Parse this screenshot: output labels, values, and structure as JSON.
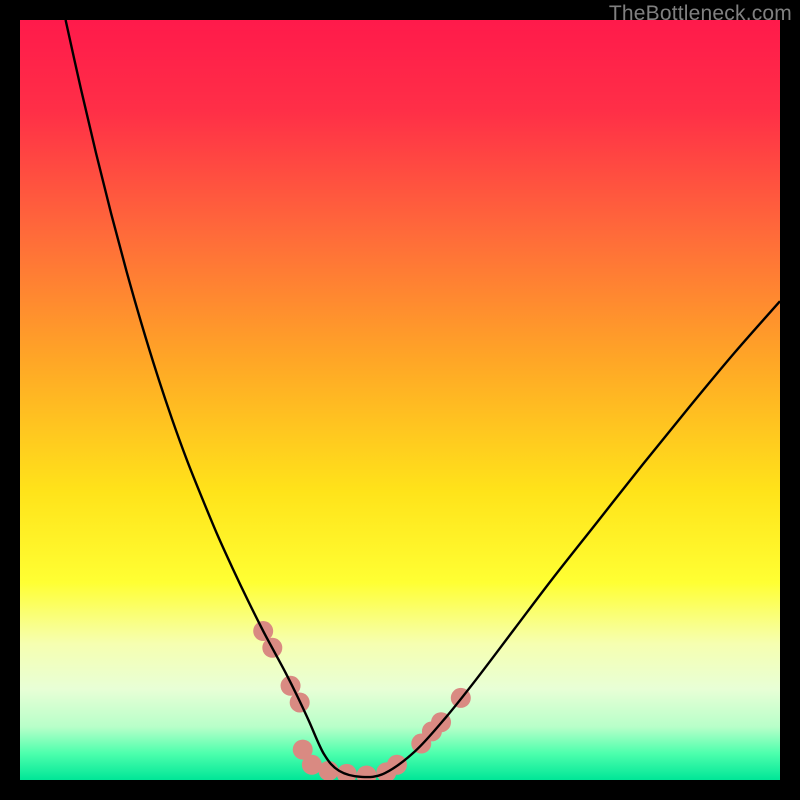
{
  "watermark": "TheBottleneck.com",
  "chart_data": {
    "type": "line",
    "title": "",
    "xlabel": "",
    "ylabel": "",
    "xlim": [
      0,
      100
    ],
    "ylim": [
      0,
      100
    ],
    "background_gradient": {
      "stops": [
        {
          "offset": 0.0,
          "color": "#ff1a4b"
        },
        {
          "offset": 0.12,
          "color": "#ff2f47"
        },
        {
          "offset": 0.28,
          "color": "#ff6a3a"
        },
        {
          "offset": 0.45,
          "color": "#ffa726"
        },
        {
          "offset": 0.62,
          "color": "#ffe31a"
        },
        {
          "offset": 0.74,
          "color": "#ffff33"
        },
        {
          "offset": 0.82,
          "color": "#f6ffb0"
        },
        {
          "offset": 0.88,
          "color": "#e8ffd6"
        },
        {
          "offset": 0.93,
          "color": "#b8ffc9"
        },
        {
          "offset": 0.965,
          "color": "#4dffad"
        },
        {
          "offset": 1.0,
          "color": "#00e697"
        }
      ]
    },
    "series": [
      {
        "name": "bottleneck-curve",
        "color": "#000000",
        "stroke_width": 2.4,
        "x": [
          6,
          8,
          10,
          12,
          14,
          16,
          18,
          20,
          22,
          24,
          26,
          28,
          30,
          32,
          33.5,
          35,
          36.5,
          38,
          40,
          42,
          45,
          48,
          52,
          56,
          60,
          65,
          70,
          76,
          82,
          88,
          94,
          100
        ],
        "values": [
          100,
          91,
          82.5,
          74.5,
          67,
          60,
          53.5,
          47.5,
          42,
          37,
          32.2,
          27.8,
          23.6,
          19.6,
          16.8,
          14,
          11,
          7.8,
          3.4,
          1.2,
          0.4,
          0.9,
          3.8,
          8.2,
          13.2,
          19.8,
          26.4,
          34,
          41.6,
          49,
          56.2,
          63
        ]
      }
    ],
    "markers": {
      "name": "highlight-markers",
      "color": "#d98a82",
      "radius": 10,
      "points": [
        {
          "x": 32.0,
          "y": 19.6
        },
        {
          "x": 33.2,
          "y": 17.4
        },
        {
          "x": 35.6,
          "y": 12.4
        },
        {
          "x": 36.8,
          "y": 10.2
        },
        {
          "x": 37.2,
          "y": 4.0
        },
        {
          "x": 38.4,
          "y": 2.0
        },
        {
          "x": 40.6,
          "y": 1.2
        },
        {
          "x": 43.0,
          "y": 0.8
        },
        {
          "x": 45.6,
          "y": 0.6
        },
        {
          "x": 48.2,
          "y": 1.0
        },
        {
          "x": 49.6,
          "y": 2.0
        },
        {
          "x": 52.8,
          "y": 4.8
        },
        {
          "x": 54.2,
          "y": 6.4
        },
        {
          "x": 55.4,
          "y": 7.6
        },
        {
          "x": 58.0,
          "y": 10.8
        }
      ]
    }
  }
}
